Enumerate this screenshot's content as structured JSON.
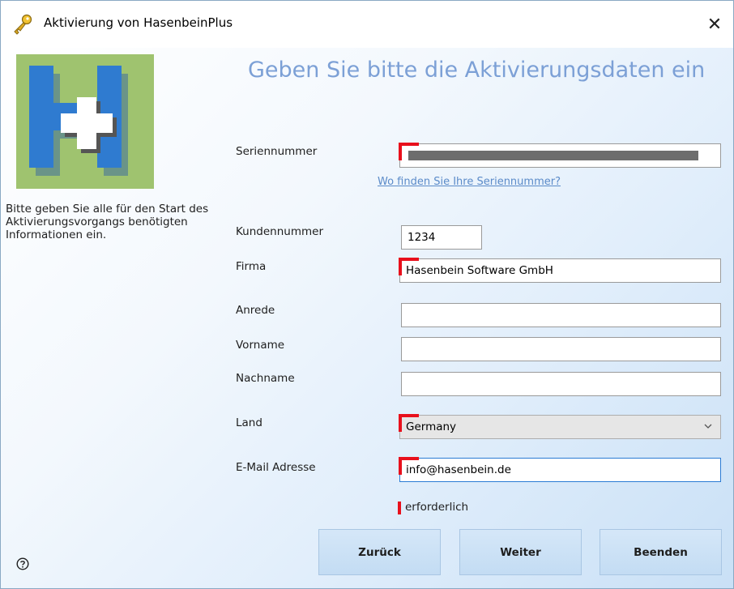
{
  "window": {
    "title": "Aktivierung von HasenbeinPlus",
    "title_icon": "key-icon",
    "close_label": "✕"
  },
  "sidebar": {
    "logo": "hasenbeinplus-logo",
    "intro_text": "Bitte geben Sie alle für den Start des Aktivierungsvorgangs benötigten Informationen ein."
  },
  "form": {
    "heading": "Geben Sie bitte die Aktivierungsdaten ein",
    "serial": {
      "label": "Seriennummer",
      "value": "",
      "required": true
    },
    "serial_help_link": "Wo finden Sie Ihre Seriennummer?",
    "customer_number": {
      "label": "Kundennummer",
      "value": "1234",
      "required": false
    },
    "company": {
      "label": "Firma",
      "value": "Hasenbein Software GmbH",
      "required": true
    },
    "salutation": {
      "label": "Anrede",
      "value": "",
      "required": false
    },
    "first_name": {
      "label": "Vorname",
      "value": "",
      "required": false
    },
    "last_name": {
      "label": "Nachname",
      "value": "",
      "required": false
    },
    "country": {
      "label": "Land",
      "selected": "Germany",
      "required": true
    },
    "email": {
      "label": "E-Mail Adresse",
      "value": "info@hasenbein.de",
      "required": true
    },
    "required_legend": "erforderlich"
  },
  "buttons": {
    "back": "Zurück",
    "next": "Weiter",
    "quit": "Beenden"
  },
  "colors": {
    "heading": "#7ca0d6",
    "required_marker": "#e8101c",
    "link": "#5b8bc9",
    "button_bg": "#c9e0f6",
    "logo_bg": "#9fc36f",
    "logo_letter": "#2f7bd0"
  }
}
